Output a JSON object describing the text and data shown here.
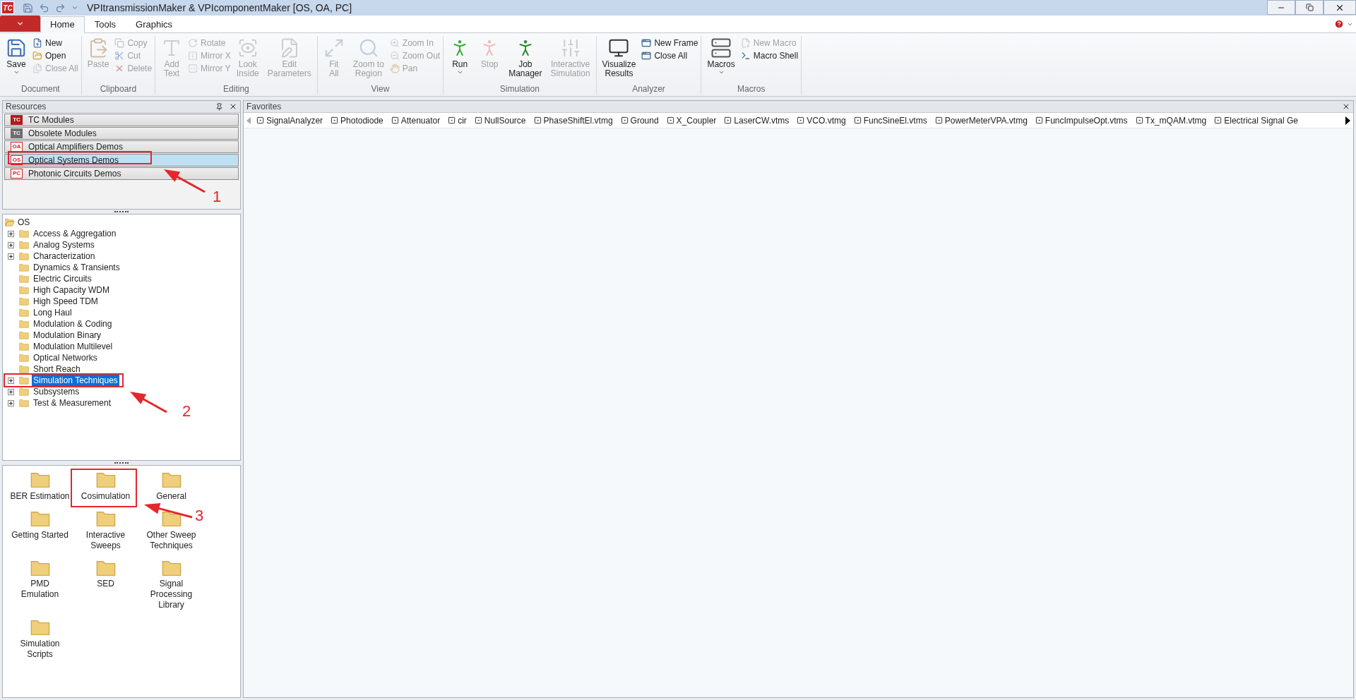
{
  "window": {
    "title": "VPItransmissionMaker & VPIcomponentMaker [OS, OA, PC]",
    "logo": "TC"
  },
  "tabs": [
    {
      "label": "Home",
      "selected": true
    },
    {
      "label": "Tools",
      "selected": false
    },
    {
      "label": "Graphics",
      "selected": false
    }
  ],
  "ribbon": [
    {
      "caption": "Document",
      "items": [
        {
          "label": "Save",
          "kind": "large",
          "disabled": false,
          "dropdown": true
        },
        {
          "label": "New",
          "kind": "small",
          "disabled": false
        },
        {
          "label": "Open",
          "kind": "small",
          "disabled": false
        },
        {
          "label": "Close All",
          "kind": "small",
          "disabled": true
        }
      ]
    },
    {
      "caption": "Clipboard",
      "items": [
        {
          "label": "Paste",
          "kind": "large",
          "disabled": true
        },
        {
          "label": "Copy",
          "kind": "small",
          "disabled": true
        },
        {
          "label": "Cut",
          "kind": "small",
          "disabled": true
        },
        {
          "label": "Delete",
          "kind": "small",
          "disabled": true
        }
      ]
    },
    {
      "caption": "Editing",
      "items": [
        {
          "label": "Add\nText",
          "kind": "large",
          "disabled": true
        },
        {
          "label": "Rotate",
          "kind": "small",
          "disabled": true
        },
        {
          "label": "Mirror X",
          "kind": "small",
          "disabled": true
        },
        {
          "label": "Mirror Y",
          "kind": "small",
          "disabled": true
        },
        {
          "label": "Look\nInside",
          "kind": "large",
          "disabled": true
        },
        {
          "label": "Edit\nParameters",
          "kind": "large",
          "disabled": true
        }
      ]
    },
    {
      "caption": "View",
      "items": [
        {
          "label": "Fit\nAll",
          "kind": "large",
          "disabled": true
        },
        {
          "label": "Zoom to\nRegion",
          "kind": "large",
          "disabled": true
        },
        {
          "label": "Zoom In",
          "kind": "small",
          "disabled": true
        },
        {
          "label": "Zoom Out",
          "kind": "small",
          "disabled": true
        },
        {
          "label": "Pan",
          "kind": "small",
          "disabled": true
        }
      ]
    },
    {
      "caption": "Simulation",
      "items": [
        {
          "label": "Run",
          "kind": "large",
          "disabled": false,
          "dropdown": true
        },
        {
          "label": "Stop",
          "kind": "large",
          "disabled": true
        },
        {
          "label": "Job\nManager",
          "kind": "large",
          "disabled": false
        },
        {
          "label": "Interactive\nSimulation",
          "kind": "large",
          "disabled": true
        }
      ]
    },
    {
      "caption": "Analyzer",
      "items": [
        {
          "label": "Visualize\nResults",
          "kind": "large",
          "disabled": false
        },
        {
          "label": "New Frame",
          "kind": "small",
          "disabled": false
        },
        {
          "label": "Close All",
          "kind": "small",
          "disabled": false
        }
      ]
    },
    {
      "caption": "Macros",
      "items": [
        {
          "label": "Macros",
          "kind": "large",
          "disabled": false,
          "dropdown": true
        },
        {
          "label": "New Macro",
          "kind": "small",
          "disabled": true
        },
        {
          "label": "Macro Shell",
          "kind": "small",
          "disabled": false
        }
      ]
    }
  ],
  "resources": {
    "title": "Resources",
    "items": [
      {
        "label": "TC Modules",
        "badge": "TC",
        "color": "#b01c1c",
        "selected": false
      },
      {
        "label": "Obsolete Modules",
        "badge": "TC",
        "color": "#6e6e6e",
        "selected": false
      },
      {
        "label": "Optical Amplifiers Demos",
        "badge": "OA",
        "color": "#d42020",
        "selected": false
      },
      {
        "label": "Optical Systems Demos",
        "badge": "OS",
        "color": "#d42020",
        "selected": true
      },
      {
        "label": "Photonic Circuits Demos",
        "badge": "PC",
        "color": "#d42020",
        "selected": false
      }
    ]
  },
  "tree": {
    "label": "OS",
    "expanded": true,
    "children": [
      {
        "label": "Access & Aggregation",
        "expandable": true,
        "selected": false
      },
      {
        "label": "Analog Systems",
        "expandable": true,
        "selected": false
      },
      {
        "label": "Characterization",
        "expandable": true,
        "selected": false
      },
      {
        "label": "Dynamics & Transients",
        "expandable": false,
        "selected": false
      },
      {
        "label": "Electric Circuits",
        "expandable": false,
        "selected": false
      },
      {
        "label": "High Capacity WDM",
        "expandable": false,
        "selected": false
      },
      {
        "label": "High Speed TDM",
        "expandable": false,
        "selected": false
      },
      {
        "label": "Long Haul",
        "expandable": false,
        "selected": false
      },
      {
        "label": "Modulation & Coding",
        "expandable": false,
        "selected": false
      },
      {
        "label": "Modulation Binary",
        "expandable": false,
        "selected": false
      },
      {
        "label": "Modulation Multilevel",
        "expandable": false,
        "selected": false
      },
      {
        "label": "Optical Networks",
        "expandable": false,
        "selected": false
      },
      {
        "label": "Short Reach",
        "expandable": false,
        "selected": false
      },
      {
        "label": "Simulation Techniques",
        "expandable": true,
        "selected": true
      },
      {
        "label": "Subsystems",
        "expandable": true,
        "selected": false
      },
      {
        "label": "Test & Measurement",
        "expandable": true,
        "selected": false
      }
    ]
  },
  "folders": [
    "BER Estimation",
    "Cosimulation",
    "General",
    "Getting Started",
    "Interactive\nSweeps",
    "Other Sweep\nTechniques",
    "PMD\nEmulation",
    "SED",
    "Signal\nProcessing\nLibrary",
    "Simulation\nScripts"
  ],
  "favorites": {
    "title": "Favorites",
    "items": [
      "SignalAnalyzer",
      "Photodiode",
      "Attenuator",
      "cir",
      "NullSource",
      "PhaseShiftEl.vtmg",
      "Ground",
      "X_Coupler",
      "LaserCW.vtms",
      "VCO.vtmg",
      "FuncSineEl.vtms",
      "PowerMeterVPA.vtmg",
      "FuncImpulseOpt.vtms",
      "Tx_mQAM.vtmg",
      "Electrical Signal Ge"
    ]
  },
  "annotations": [
    {
      "label": "1"
    },
    {
      "label": "2"
    },
    {
      "label": "3"
    }
  ]
}
